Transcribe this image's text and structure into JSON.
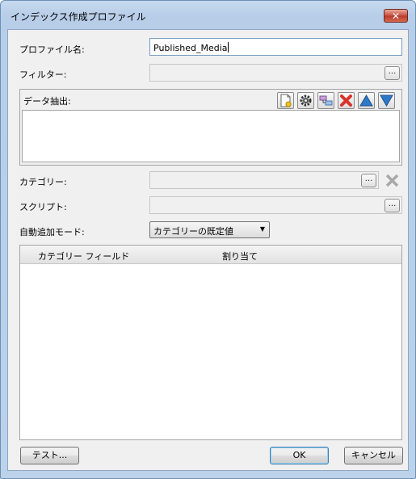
{
  "window": {
    "title": "インデックス作成プロファイル",
    "close_symbol": "✕"
  },
  "form": {
    "profile_name_label": "プロファイル名:",
    "profile_name_value": "Published_Media",
    "filter_label": "フィルター:",
    "filter_value": "",
    "data_extraction_label": "データ抽出:",
    "category_label": "カテゴリー:",
    "category_value": "",
    "script_label": "スクリプト:",
    "script_value": "",
    "auto_add_mode_label": "自動追加モード:",
    "auto_add_mode_selected": "カテゴリーの既定値",
    "browse_label": "..."
  },
  "toolbar_icons": [
    "new-document-icon",
    "gear-icon",
    "link-icon",
    "delete-icon",
    "arrow-up-icon",
    "arrow-down-icon"
  ],
  "grid": {
    "columns": [
      "カテゴリー フィールド",
      "割り当て"
    ],
    "rows": []
  },
  "buttons": {
    "test": "テスト...",
    "ok": "OK",
    "cancel": "キャンセル"
  },
  "colors": {
    "titlebar": "#bcd1ea",
    "close_button": "#c75043",
    "delete_icon": "#d9342b",
    "arrow_icon": "#2f78c8"
  }
}
